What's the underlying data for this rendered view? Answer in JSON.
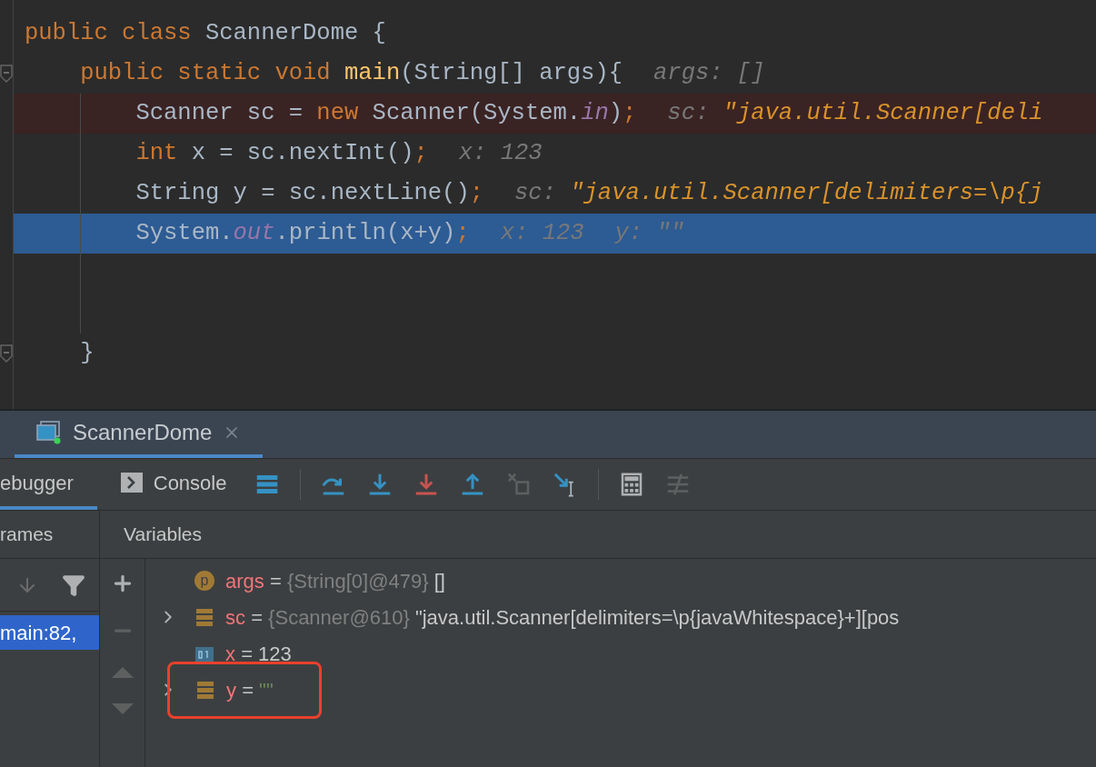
{
  "editor": {
    "lines": [
      {
        "kind": "code",
        "tokens": [
          {
            "kind": "keyword",
            "text": "public class "
          },
          {
            "kind": "plain",
            "text": "ScannerDome {"
          }
        ]
      },
      {
        "kind": "code",
        "fold": true,
        "tokens": [
          {
            "kind": "keyword",
            "text": "    public static void "
          },
          {
            "kind": "method",
            "text": "main"
          },
          {
            "kind": "plain",
            "text": "(String[] args){"
          }
        ],
        "hints": [
          {
            "label": "args:",
            "value": "[]",
            "string": false
          }
        ]
      },
      {
        "kind": "code",
        "breakpoint": true,
        "tokens": [
          {
            "kind": "plain",
            "text": "        Scanner sc = "
          },
          {
            "kind": "keyword",
            "text": "new "
          },
          {
            "kind": "plain",
            "text": "Scanner(System."
          },
          {
            "kind": "field",
            "text": "in"
          },
          {
            "kind": "plain",
            "text": ")"
          },
          {
            "kind": "keyword",
            "text": ";"
          }
        ],
        "hints": [
          {
            "label": "sc:",
            "value": "\"java.util.Scanner[deli",
            "string": true
          }
        ]
      },
      {
        "kind": "code",
        "tokens": [
          {
            "kind": "keyword",
            "text": "        int "
          },
          {
            "kind": "plain",
            "text": "x = sc.nextInt()"
          },
          {
            "kind": "keyword",
            "text": ";"
          }
        ],
        "hints": [
          {
            "label": "x:",
            "value": "123",
            "string": false
          }
        ]
      },
      {
        "kind": "code",
        "tokens": [
          {
            "kind": "plain",
            "text": "        String y = sc.nextLine()"
          },
          {
            "kind": "keyword",
            "text": ";"
          }
        ],
        "hints": [
          {
            "label": "sc:",
            "value": "\"java.util.Scanner[delimiters=\\p{j",
            "string": true
          }
        ]
      },
      {
        "kind": "code",
        "current": true,
        "tokens": [
          {
            "kind": "plain",
            "text": "        System."
          },
          {
            "kind": "field",
            "text": "out"
          },
          {
            "kind": "plain",
            "text": ".println(x+y)"
          },
          {
            "kind": "keyword",
            "text": ";"
          }
        ],
        "hints": [
          {
            "label": "x:",
            "value": "123",
            "string": false
          },
          {
            "label": "y:",
            "value": "\"\"",
            "string": false
          }
        ]
      },
      {
        "kind": "blank"
      },
      {
        "kind": "blank"
      },
      {
        "kind": "code",
        "fold": true,
        "tokens": [
          {
            "kind": "plain",
            "text": "    }"
          }
        ]
      }
    ]
  },
  "run_tab": {
    "title": "ScannerDome",
    "selected": true
  },
  "tabs": [
    {
      "label": "ebugger",
      "selected": true
    },
    {
      "label": "Console",
      "selected": false
    }
  ],
  "toolbar": [
    {
      "kind": "layout",
      "disabled": false
    },
    {
      "kind": "step-over",
      "disabled": false
    },
    {
      "kind": "step-into",
      "disabled": false
    },
    {
      "kind": "force-step-into",
      "disabled": false
    },
    {
      "kind": "step-out",
      "disabled": false
    },
    {
      "kind": "drop-frame",
      "disabled": true
    },
    {
      "kind": "run-to-cursor",
      "disabled": false
    },
    {
      "kind": "evaluate",
      "disabled": false
    },
    {
      "kind": "trace",
      "disabled": true
    }
  ],
  "frames": {
    "title": "rames",
    "items": [
      {
        "label": "main:82, ",
        "selected": true
      }
    ]
  },
  "variables": {
    "title": "Variables",
    "items": [
      {
        "kind": "param",
        "icon_text": "p",
        "name": "args",
        "operator": "=",
        "type": "{String[0]@479}",
        "value": "[]",
        "string_value": false
      },
      {
        "kind": "object",
        "expandable": true,
        "name": "sc",
        "operator": "=",
        "type": "{Scanner@610}",
        "value": "\"java.util.Scanner[delimiters=\\p{javaWhitespace}+][pos",
        "string_value": false
      },
      {
        "kind": "primitive",
        "name": "x",
        "operator": "=",
        "value": "123",
        "string_value": false
      },
      {
        "kind": "object",
        "expandable": true,
        "annotated": true,
        "name": "y",
        "operator": "=",
        "value": "\"\"",
        "string_value": true
      }
    ]
  }
}
